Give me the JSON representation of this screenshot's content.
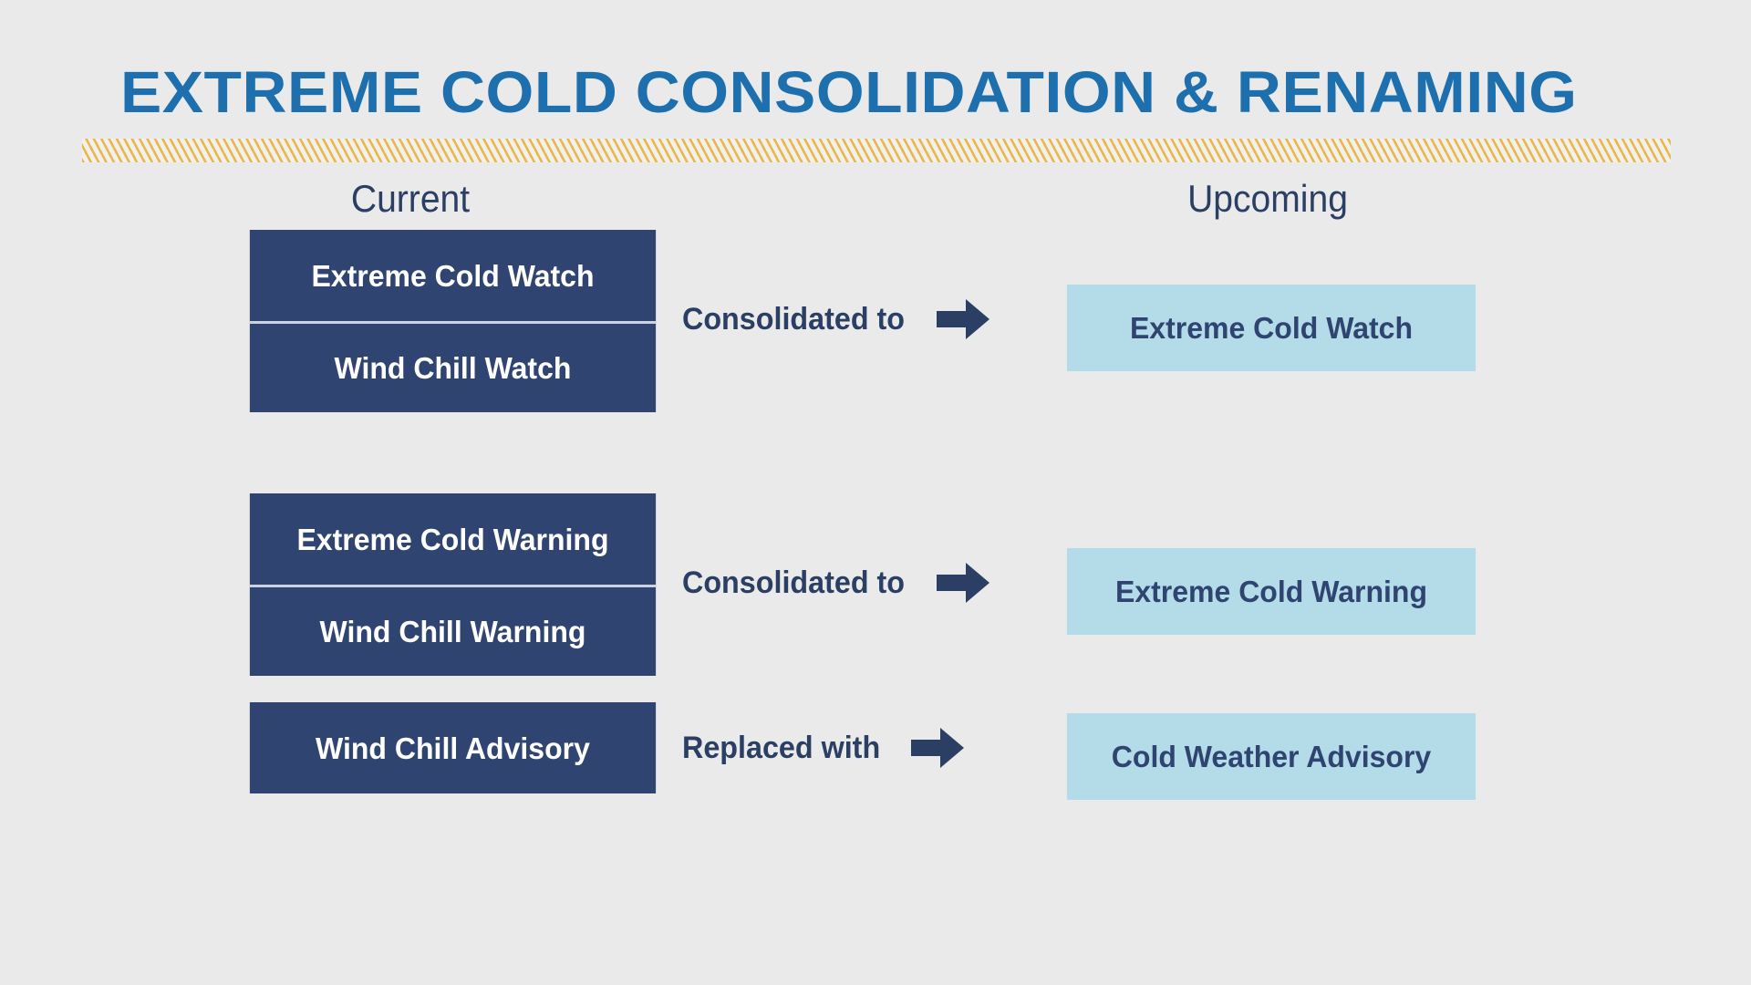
{
  "slide": {
    "title": "Extreme Cold Consolidation & Renaming",
    "background_color": "#eaeaea",
    "title_color": "#1d70ad",
    "stripe_color": "#e8b74d",
    "current_box_color": "#2f4470",
    "upcoming_box_color": "#b4dbe8",
    "arrow_color": "#2a3f63"
  },
  "columns": {
    "current_header": "Current",
    "upcoming_header": "Upcoming"
  },
  "groups": [
    {
      "current_items": [
        "Extreme Cold Watch",
        "Wind Chill Watch"
      ],
      "relation": "Consolidated to",
      "arrow_icon": "right-arrow-icon",
      "upcoming_item": "Extreme Cold Watch"
    },
    {
      "current_items": [
        "Extreme Cold Warning",
        "Wind Chill Warning"
      ],
      "relation": "Consolidated to",
      "arrow_icon": "right-arrow-icon",
      "upcoming_item": "Extreme Cold Warning"
    },
    {
      "current_items": [
        "Wind Chill Advisory"
      ],
      "relation": "Replaced with",
      "arrow_icon": "right-arrow-icon",
      "upcoming_item": "Cold Weather Advisory"
    }
  ]
}
